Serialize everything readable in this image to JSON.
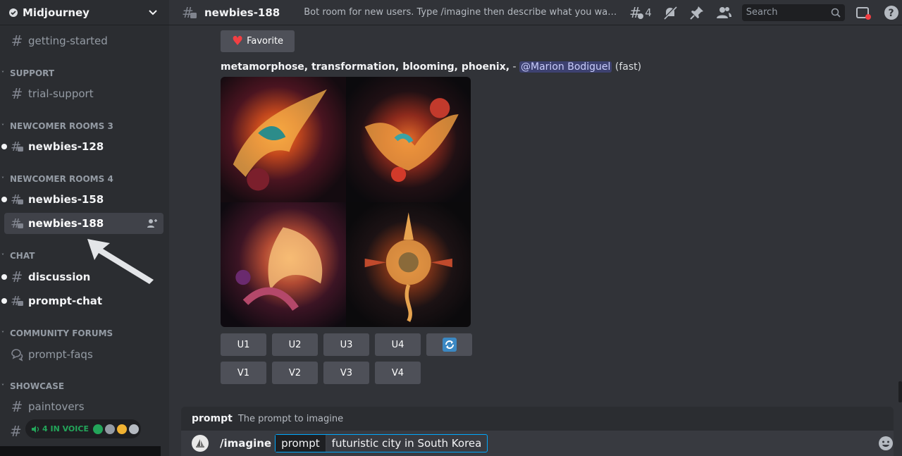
{
  "server": {
    "name": "Midjourney"
  },
  "sidebar": {
    "top_channel": "getting-started",
    "sections": [
      {
        "label": "SUPPORT"
      },
      {
        "label": "NEWCOMER ROOMS 3"
      },
      {
        "label": "NEWCOMER ROOMS 4"
      },
      {
        "label": "CHAT"
      },
      {
        "label": "COMMUNITY FORUMS"
      },
      {
        "label": "SHOWCASE"
      }
    ],
    "channels": {
      "trial_support": "trial-support",
      "newbies_128": "newbies-128",
      "newbies_158": "newbies-158",
      "newbies_188": "newbies-188",
      "discussion": "discussion",
      "prompt_chat": "prompt-chat",
      "prompt_faqs": "prompt-faqs",
      "paintovers": "paintovers"
    },
    "voice_pill": "4 IN VOICE"
  },
  "header": {
    "channel": "newbies-188",
    "topic": "Bot room for new users. Type /imagine then describe what you want to draw. S",
    "thread_count": "4",
    "search_placeholder": "Search"
  },
  "message": {
    "favorite_label": "Favorite",
    "prompt_text": "metamorphose, transformation, blooming, phoenix,",
    "separator": " - ",
    "mention": "@Marion Bodiguel",
    "mode": "(fast)"
  },
  "buttons": {
    "upscale": [
      "U1",
      "U2",
      "U3",
      "U4"
    ],
    "variation": [
      "V1",
      "V2",
      "V3",
      "V4"
    ]
  },
  "composer": {
    "hint_name": "prompt",
    "hint_desc": "The prompt to imagine",
    "command": "/imagine",
    "option_key": "prompt",
    "option_value": "futuristic city in South Korea"
  },
  "colors": {
    "accent": "#00a8fc",
    "mention_bg": "#3c4270",
    "button": "#4e5058",
    "voice_green": "#23a55a"
  }
}
